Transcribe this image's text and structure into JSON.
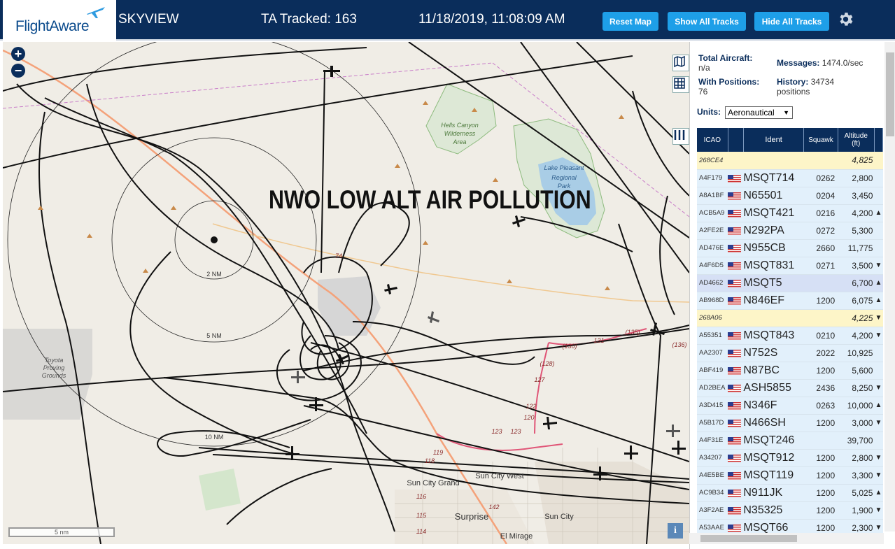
{
  "header": {
    "logo_text": "FlightAware",
    "app_name": "SKYVIEW",
    "tracked": "TA Tracked: 163",
    "datetime": "11/18/2019, 11:08:09 AM",
    "reset_map": "Reset Map",
    "show_all": "Show All Tracks",
    "hide_all": "Hide All Tracks"
  },
  "map": {
    "overlay_title": "NWO LOW ALT AIR POLLUTION",
    "zoom_in": "+",
    "zoom_out": "−",
    "scale_label": "5 nm",
    "info": "i",
    "labels": {
      "hells_canyon": "Hells Canyon",
      "wilderness": "Wilderness",
      "area": "Area",
      "lake_pleasant": "Lake Pleasant",
      "regional": "Regional",
      "park": "Park",
      "toyota": "Toyota",
      "proving": "Proving",
      "grounds": "Grounds",
      "sun_city_grand": "Sun City Grand",
      "sun_city_west": "Sun City West",
      "surprise": "Surprise",
      "sun_city": "Sun City",
      "el_mirage": "El Mirage",
      "ring_2": "2 NM",
      "ring_5": "5 NM",
      "ring_10": "10 NM",
      "r74": "74",
      "r130": "(130)",
      "r131": "131",
      "r128": "(128)",
      "r127": "127",
      "r135": "(135)",
      "r136": "(136)",
      "r122": "122",
      "r120": "120",
      "r123": "123",
      "r123b": "123",
      "r119": "119",
      "r118": "118",
      "r116": "116",
      "r115": "115",
      "r114": "114",
      "r142": "142"
    }
  },
  "panel": {
    "total_label": "Total Aircraft:",
    "total_value": "n/a",
    "messages_label": "Messages:",
    "messages_value": "1474.0/sec",
    "positions_label": "With Positions:",
    "positions_value": "76",
    "history_label": "History:",
    "history_value": "34734",
    "history_unit": "positions",
    "units_label": "Units:",
    "units_value": "Aeronautical",
    "columns": {
      "icao": "ICAO",
      "ident": "Ident",
      "squawk": "Squawk",
      "altitude": "Altitude",
      "alt_unit": "(ft)"
    },
    "rows": [
      {
        "icao": "268CE4",
        "flag": false,
        "ident": "",
        "squawk": "",
        "altitude": "4,825",
        "trend": "",
        "style": "Y"
      },
      {
        "icao": "A4F179",
        "flag": true,
        "ident": "MSQT714",
        "squawk": "0262",
        "altitude": "2,800",
        "trend": "",
        "style": "A"
      },
      {
        "icao": "A8A1BF",
        "flag": true,
        "ident": "N65501",
        "squawk": "0204",
        "altitude": "3,450",
        "trend": "",
        "style": "A"
      },
      {
        "icao": "ACB5A9",
        "flag": true,
        "ident": "MSQT421",
        "squawk": "0216",
        "altitude": "4,200",
        "trend": "▲",
        "style": "A"
      },
      {
        "icao": "A2FE2E",
        "flag": true,
        "ident": "N292PA",
        "squawk": "0272",
        "altitude": "5,300",
        "trend": "",
        "style": "A"
      },
      {
        "icao": "AD476E",
        "flag": true,
        "ident": "N955CB",
        "squawk": "2660",
        "altitude": "11,775",
        "trend": "",
        "style": "A"
      },
      {
        "icao": "A4F6D5",
        "flag": true,
        "ident": "MSQT831",
        "squawk": "0271",
        "altitude": "3,500",
        "trend": "▼",
        "style": "A"
      },
      {
        "icao": "AD4662",
        "flag": true,
        "ident": "MSQT5",
        "squawk": "",
        "altitude": "6,700",
        "trend": "▲",
        "style": "Sel"
      },
      {
        "icao": "AB968D",
        "flag": true,
        "ident": "N846EF",
        "squawk": "1200",
        "altitude": "6,075",
        "trend": "▲",
        "style": "A"
      },
      {
        "icao": "268A06",
        "flag": false,
        "ident": "",
        "squawk": "",
        "altitude": "4,225",
        "trend": "▼",
        "style": "Y"
      },
      {
        "icao": "A55351",
        "flag": true,
        "ident": "MSQT843",
        "squawk": "0210",
        "altitude": "4,200",
        "trend": "▼",
        "style": "A"
      },
      {
        "icao": "AA2307",
        "flag": true,
        "ident": "N752S",
        "squawk": "2022",
        "altitude": "10,925",
        "trend": "",
        "style": "A"
      },
      {
        "icao": "ABF419",
        "flag": true,
        "ident": "N87BC",
        "squawk": "1200",
        "altitude": "5,600",
        "trend": "",
        "style": "A"
      },
      {
        "icao": "AD2BEA",
        "flag": true,
        "ident": "ASH5855",
        "squawk": "2436",
        "altitude": "8,250",
        "trend": "▼",
        "style": "A"
      },
      {
        "icao": "A3D415",
        "flag": true,
        "ident": "N346F",
        "squawk": "0263",
        "altitude": "10,000",
        "trend": "▲",
        "style": "A"
      },
      {
        "icao": "A5B17D",
        "flag": true,
        "ident": "N466SH",
        "squawk": "1200",
        "altitude": "3,000",
        "trend": "▼",
        "style": "A"
      },
      {
        "icao": "A4F31E",
        "flag": true,
        "ident": "MSQT246",
        "squawk": "",
        "altitude": "39,700",
        "trend": "",
        "style": "A"
      },
      {
        "icao": "A34207",
        "flag": true,
        "ident": "MSQT912",
        "squawk": "1200",
        "altitude": "2,800",
        "trend": "▼",
        "style": "A"
      },
      {
        "icao": "A4E5BE",
        "flag": true,
        "ident": "MSQT119",
        "squawk": "1200",
        "altitude": "3,300",
        "trend": "▼",
        "style": "A"
      },
      {
        "icao": "AC9B34",
        "flag": true,
        "ident": "N911JK",
        "squawk": "1200",
        "altitude": "5,025",
        "trend": "▲",
        "style": "A"
      },
      {
        "icao": "A3F2AE",
        "flag": true,
        "ident": "N35325",
        "squawk": "1200",
        "altitude": "1,900",
        "trend": "▼",
        "style": "A"
      },
      {
        "icao": "A53AAE",
        "flag": true,
        "ident": "MSQT66",
        "squawk": "1200",
        "altitude": "2,300",
        "trend": "▼",
        "style": "A"
      }
    ]
  },
  "colors": {
    "header_bg": "#0a2d5b",
    "button": "#1e9fe8",
    "row": "#e2f0fb",
    "row_highlight": "#fdf5c8",
    "row_selected": "#d6e0f5",
    "track": "#111111",
    "lake": "#a9cde6"
  }
}
